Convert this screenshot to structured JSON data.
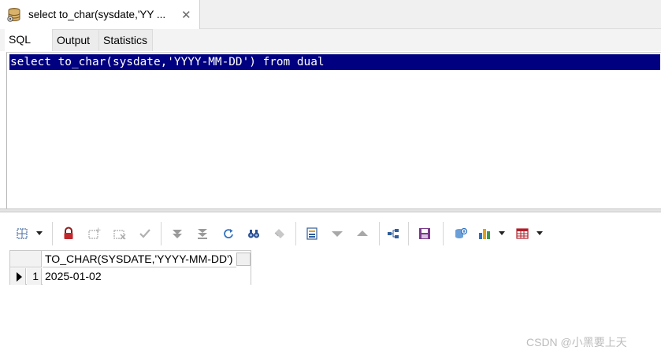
{
  "document_tab": {
    "title": "select to_char(sysdate,'YY ...",
    "close_glyph": "✕"
  },
  "subtabs": [
    {
      "label": "SQL",
      "active": true
    },
    {
      "label": "Output",
      "active": false
    },
    {
      "label": "Statistics",
      "active": false
    }
  ],
  "editor": {
    "sql": "select to_char(sysdate,'YYYY-MM-DD') from dual",
    "selection_color": "#000080"
  },
  "toolbar": {
    "icons": [
      "grid-options-icon",
      "lock-icon",
      "insert-record-icon",
      "delete-record-icon",
      "post-changes-icon",
      "fetch-next-icon",
      "fetch-last-icon",
      "refresh-icon",
      "find-icon",
      "clear-icon",
      "single-record-view-icon",
      "previous-record-icon",
      "next-record-icon",
      "query-by-example-icon",
      "save-icon",
      "export-icon",
      "chart-icon",
      "table-view-icon"
    ]
  },
  "grid": {
    "columns": [
      "TO_CHAR(SYSDATE,'YYYY-MM-DD')"
    ],
    "rows": [
      {
        "row_number": "1",
        "values": [
          "2025-01-02"
        ]
      }
    ]
  },
  "watermark": "CSDN @小黑要上天"
}
